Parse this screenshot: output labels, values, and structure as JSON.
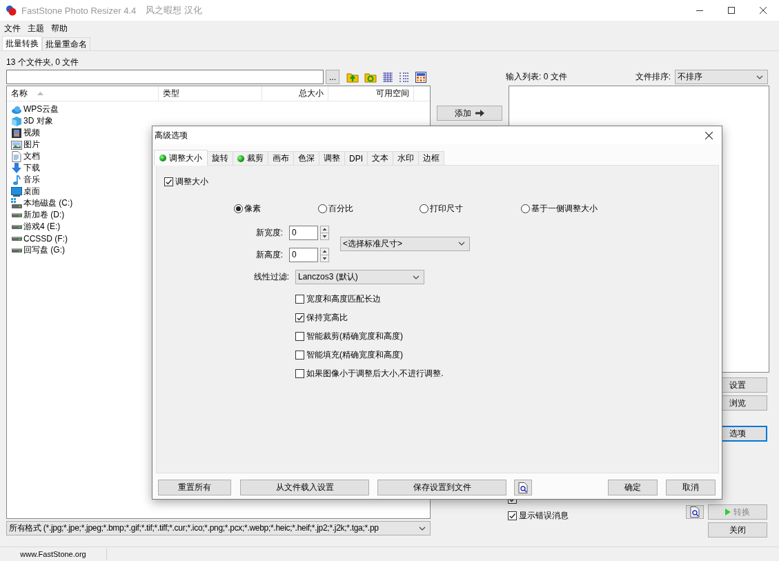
{
  "window": {
    "title": "FastStone Photo Resizer 4.4",
    "subtitle": "风之暇想 汉化"
  },
  "menu": [
    "文件",
    "主题",
    "帮助"
  ],
  "main_tabs": [
    {
      "label": "批量转换",
      "selected": true
    },
    {
      "label": "批量重命名",
      "selected": false
    }
  ],
  "folder_summary": "13 个文件夹, 0 文件",
  "browse_button": "...",
  "file_list": {
    "columns": [
      "名称",
      "类型",
      "总大小",
      "可用空间"
    ],
    "items": [
      {
        "name": "WPS云盘",
        "kind": "cloud"
      },
      {
        "name": "3D 对象",
        "kind": "cube"
      },
      {
        "name": "视频",
        "kind": "video"
      },
      {
        "name": "图片",
        "kind": "picture"
      },
      {
        "name": "文档",
        "kind": "document"
      },
      {
        "name": "下载",
        "kind": "download"
      },
      {
        "name": "音乐",
        "kind": "music"
      },
      {
        "name": "桌面",
        "kind": "desktop"
      },
      {
        "name": "本地磁盘 (C:)",
        "kind": "system_drive"
      },
      {
        "name": "新加卷 (D:)",
        "kind": "drive"
      },
      {
        "name": "游戏4 (E:)",
        "kind": "drive"
      },
      {
        "name": "CCSSD (F:)",
        "kind": "drive"
      },
      {
        "name": "回写盘 (G:)",
        "kind": "drive"
      }
    ]
  },
  "filter": "所有格式 (*.jpg;*.jpe;*.jpeg;*.bmp;*.gif;*.tif;*.tiff;*.cur;*.ico;*.png;*.pcx;*.webp;*.heic;*.heif;*.jp2;*.j2k;*.tga;*.pp",
  "add_button": "添加",
  "input_list": {
    "label": "输入列表: 0 文件",
    "sort_label": "文件排序:",
    "sort_value": "不排序"
  },
  "side_buttons": [
    {
      "label": "设置",
      "focused": false
    },
    {
      "label": "浏览",
      "focused": false
    },
    {
      "label": "选项",
      "focused": true
    }
  ],
  "checks": [
    {
      "checked": true
    },
    {
      "label": "显示错误消息",
      "checked": true
    }
  ],
  "convert_button": "转换",
  "close_button": "关闭",
  "status_bar": "www.FastStone.org",
  "dialog": {
    "title": "高级选项",
    "tabs": [
      {
        "label": "调整大小",
        "selected": true,
        "enabled": true
      },
      {
        "label": "旋转",
        "selected": false,
        "enabled": false
      },
      {
        "label": "裁剪",
        "selected": false,
        "enabled": true
      },
      {
        "label": "画布",
        "selected": false,
        "enabled": false
      },
      {
        "label": "色深",
        "selected": false,
        "enabled": false
      },
      {
        "label": "调整",
        "selected": false,
        "enabled": false
      },
      {
        "label": "DPI",
        "selected": false,
        "enabled": false
      },
      {
        "label": "文本",
        "selected": false,
        "enabled": false
      },
      {
        "label": "水印",
        "selected": false,
        "enabled": false
      },
      {
        "label": "边框",
        "selected": false,
        "enabled": false
      }
    ],
    "resize": {
      "label": "调整大小",
      "checked": true
    },
    "modes": [
      {
        "label": "像素",
        "selected": true
      },
      {
        "label": "百分比",
        "selected": false
      },
      {
        "label": "打印尺寸",
        "selected": false
      },
      {
        "label": "基于一侧调整大小",
        "selected": false
      }
    ],
    "width": {
      "label": "新宽度:",
      "value": "0"
    },
    "height": {
      "label": "新高度:",
      "value": "0"
    },
    "standard_size": "<选择标准尺寸>",
    "filter": {
      "label": "线性过滤:",
      "value": "Lanczos3 (默认)"
    },
    "options": [
      {
        "label": "宽度和高度匹配长边",
        "checked": false
      },
      {
        "label": "保持宽高比",
        "checked": true
      },
      {
        "label": "智能裁剪(精确宽度和高度)",
        "checked": false
      },
      {
        "label": "智能填充(精确宽度和高度)",
        "checked": false
      },
      {
        "label": "如果图像小于调整后大小,不进行调整.",
        "checked": false
      }
    ],
    "buttons": {
      "reset": "重置所有",
      "load": "从文件载入设置",
      "save": "保存设置到文件",
      "ok": "确定",
      "cancel": "取消"
    }
  }
}
